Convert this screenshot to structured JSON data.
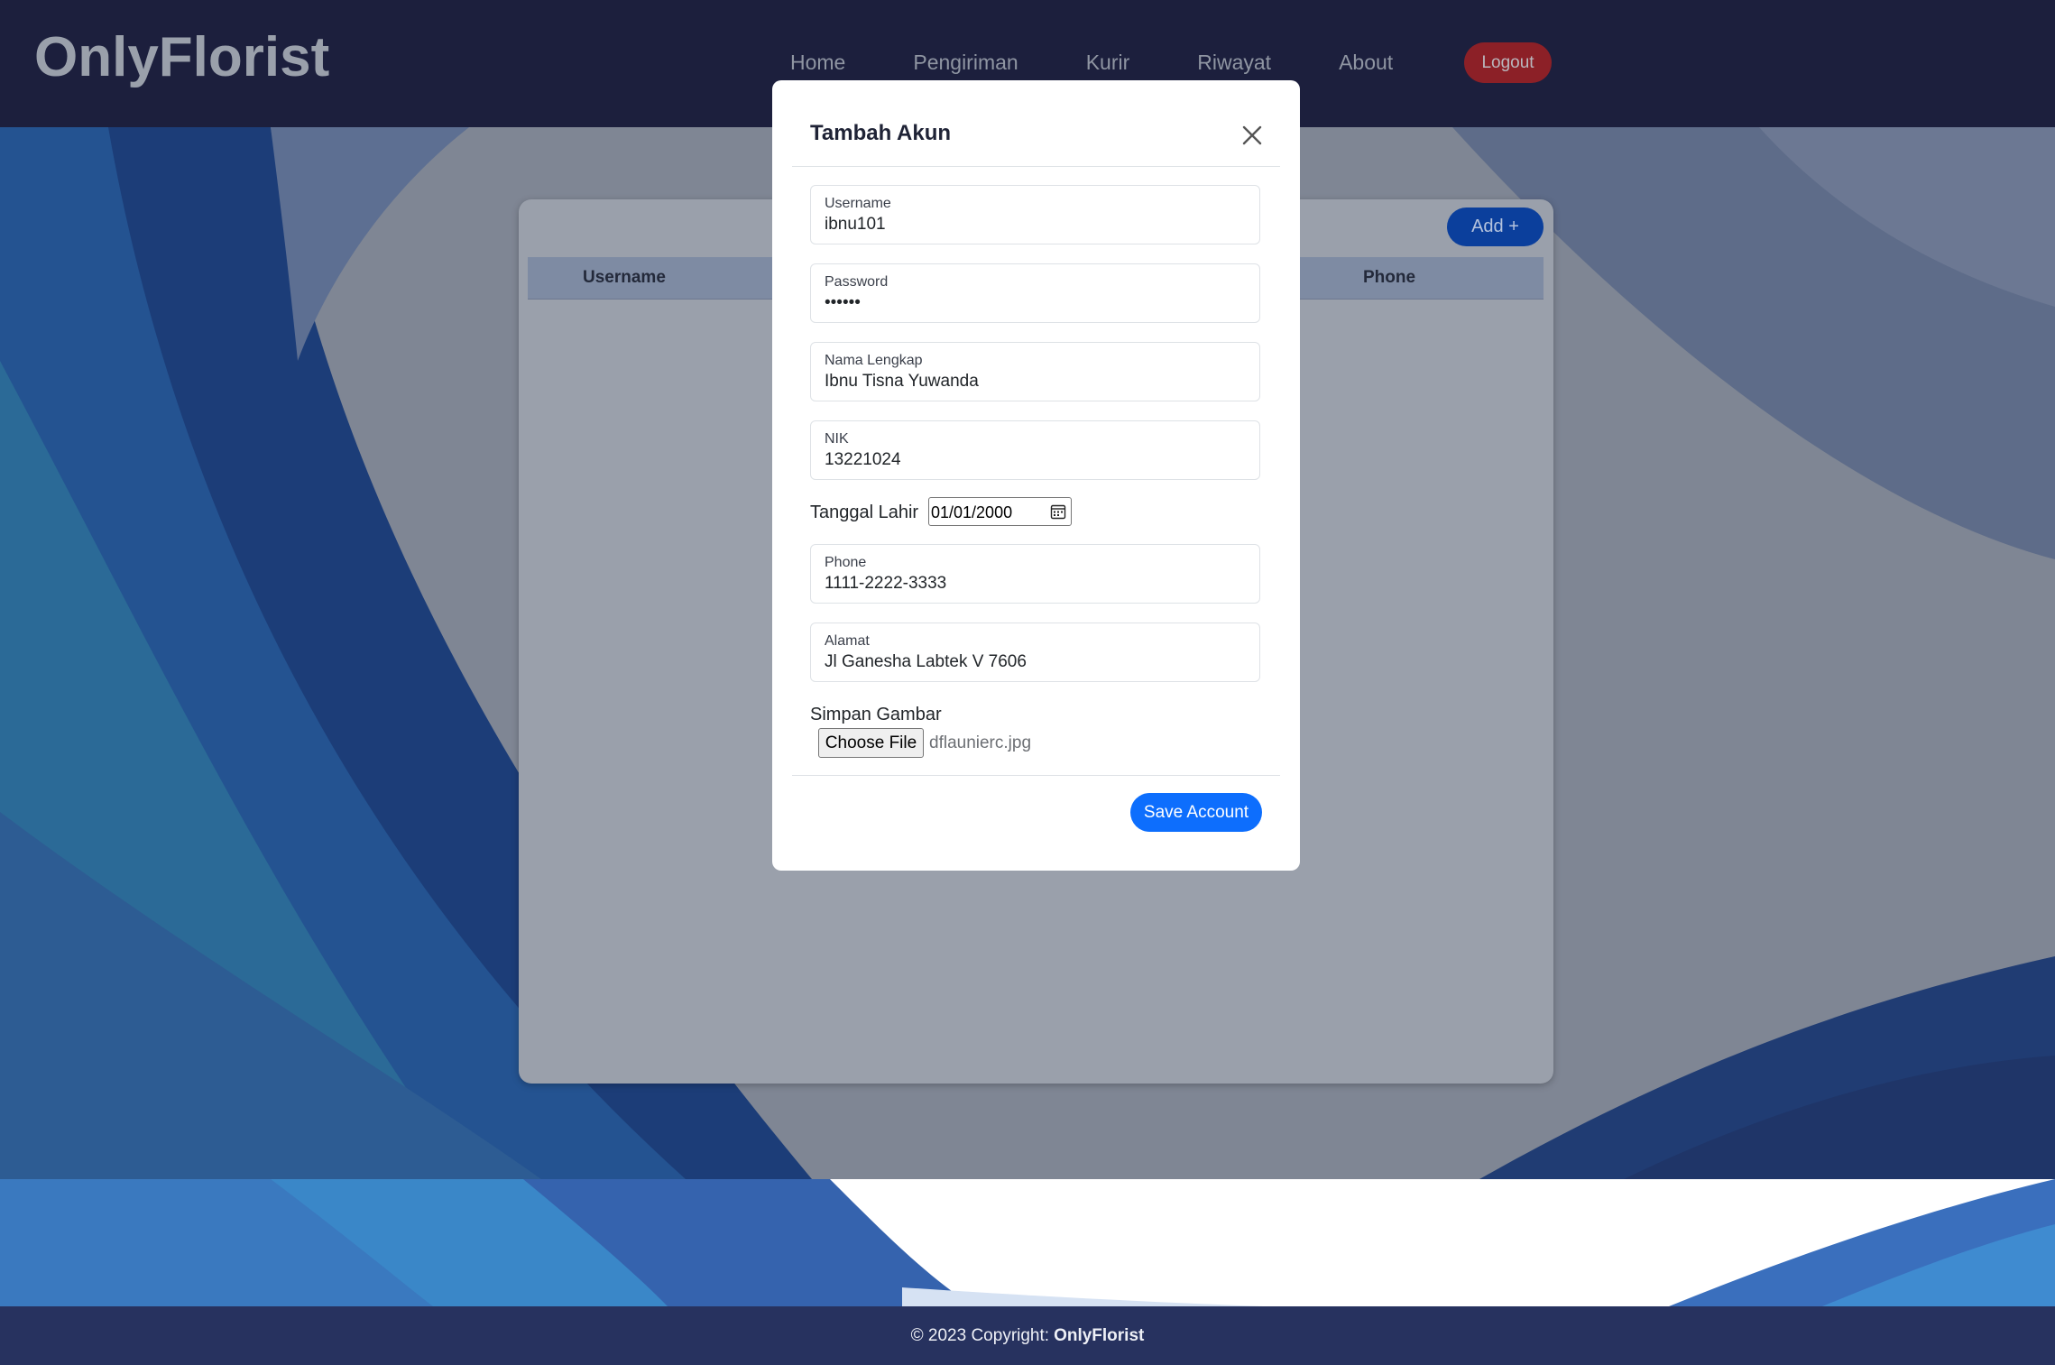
{
  "brand": "OnlyFlorist",
  "nav": {
    "items": [
      {
        "label": "Home"
      },
      {
        "label": "Pengiriman"
      },
      {
        "label": "Kurir"
      },
      {
        "label": "Riwayat"
      },
      {
        "label": "About"
      }
    ],
    "logout_label": "Logout"
  },
  "card": {
    "add_label": "Add +",
    "columns": [
      "Username",
      "Phone"
    ]
  },
  "modal": {
    "title": "Tambah Akun",
    "fields": [
      {
        "label": "Username",
        "value": "ibnu101"
      },
      {
        "label": "Password",
        "value": "••••••"
      },
      {
        "label": "Nama Lengkap",
        "value": "Ibnu Tisna Yuwanda"
      },
      {
        "label": "NIK",
        "value": "13221024"
      },
      {
        "label": "Phone",
        "value": "1111-2222-3333"
      },
      {
        "label": "Alamat",
        "value": "Jl Ganesha Labtek V 7606"
      }
    ],
    "date": {
      "label": "Tanggal Lahir",
      "value": "01/01/2000"
    },
    "file": {
      "label": "Simpan Gambar",
      "button": "Choose File",
      "filename": "dflaunierc.jpg"
    },
    "save_label": "Save Account"
  },
  "footer": {
    "text": "© 2023 Copyright:",
    "brand": "OnlyFlorist"
  },
  "colors": {
    "navbar": "#1c1f3d",
    "primary": "#0d6efd",
    "logout": "#dc3545",
    "footer": "#27325f"
  }
}
